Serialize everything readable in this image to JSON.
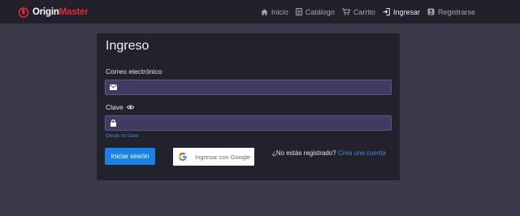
{
  "brand": {
    "part1": "Origin",
    "part2": "Master",
    "icon": "flame-logo-icon",
    "accent": "#e02a36"
  },
  "nav": {
    "items": [
      {
        "label": "Inicio",
        "icon": "home-icon"
      },
      {
        "label": "Catálogo",
        "icon": "book-icon"
      },
      {
        "label": "Carrito",
        "icon": "cart-icon"
      },
      {
        "label": "Ingresar",
        "icon": "sign-in-icon",
        "active": true
      },
      {
        "label": "Registrarse",
        "icon": "id-card-icon"
      }
    ]
  },
  "login": {
    "title": "Ingreso",
    "email_label": "Correo electrónico",
    "email_value": "",
    "password_label": "Clave",
    "password_value": "",
    "forgot": "Olvide mi clave",
    "submit": "Iniciar sesión",
    "google": "Ingresar con Google",
    "register_prompt": "¿No estás registrado?",
    "register_link": "Crea una cuenta"
  },
  "colors": {
    "navbar_bg": "#21202b",
    "page_bg": "#3b3a4a",
    "card_bg": "#22212c",
    "input_bg": "#3f3c64",
    "primary": "#1a82e6",
    "link": "#3f8cde"
  }
}
